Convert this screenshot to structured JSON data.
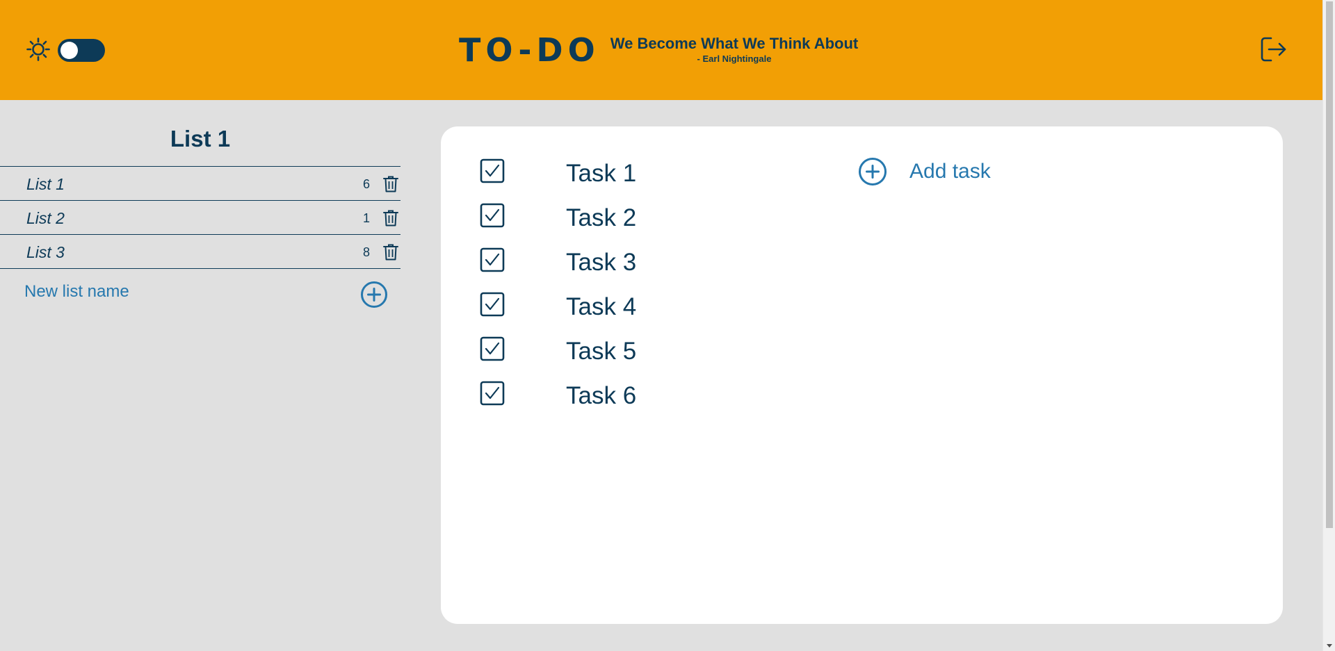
{
  "header": {
    "title": "TO-DO",
    "quote": "We Become What We Think About",
    "quote_author": "- Earl Nightingale",
    "theme_toggle_icon": "sun-icon",
    "logout_icon": "logout-icon"
  },
  "sidebar": {
    "title": "List 1",
    "lists": [
      {
        "name": "List 1",
        "count": "6"
      },
      {
        "name": "List 2",
        "count": "1"
      },
      {
        "name": "List 3",
        "count": "8"
      }
    ],
    "new_list_placeholder": "New list name"
  },
  "tasks": {
    "items": [
      {
        "label": "Task 1",
        "checked": true
      },
      {
        "label": "Task 2",
        "checked": true
      },
      {
        "label": "Task 3",
        "checked": true
      },
      {
        "label": "Task 4",
        "checked": true
      },
      {
        "label": "Task 5",
        "checked": true
      },
      {
        "label": "Task 6",
        "checked": true
      }
    ],
    "add_task_label": "Add task"
  },
  "colors": {
    "header_bg": "#f29f05",
    "primary_text": "#0d3a57",
    "accent": "#2678ae",
    "page_bg": "#e0e0e0",
    "panel_bg": "#ffffff"
  }
}
